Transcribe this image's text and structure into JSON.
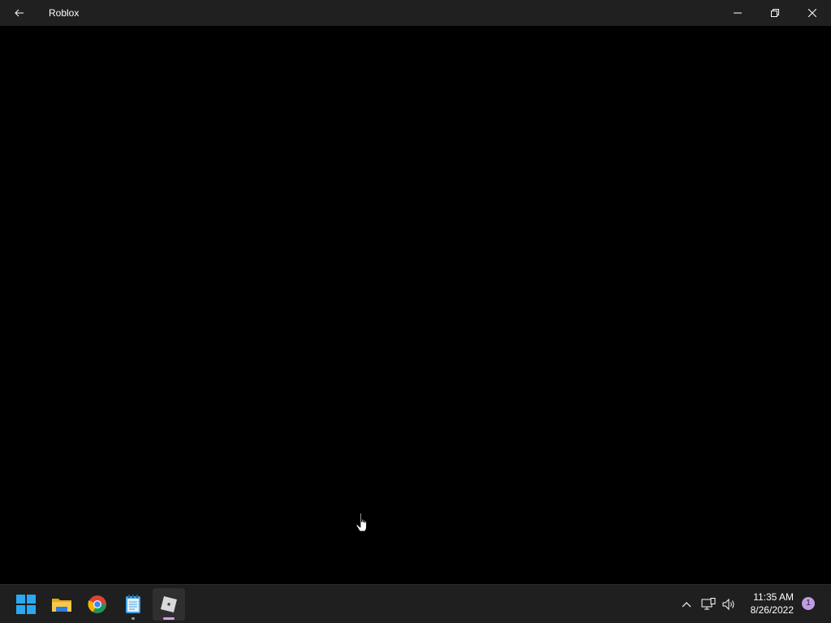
{
  "window": {
    "title": "Roblox"
  },
  "taskbar": {
    "apps": [
      {
        "name": "start",
        "icon": "windows-logo-icon"
      },
      {
        "name": "file-explorer",
        "icon": "folder-icon"
      },
      {
        "name": "chrome",
        "icon": "chrome-icon"
      },
      {
        "name": "notepad",
        "icon": "notepad-icon"
      },
      {
        "name": "roblox",
        "icon": "roblox-icon",
        "active": true
      }
    ],
    "clock": {
      "time": "11:35 AM",
      "date": "8/26/2022"
    },
    "notification_count": "1"
  },
  "colors": {
    "titlebar_bg": "#202020",
    "taskbar_bg": "#1f1f1f",
    "content_bg": "#000000",
    "accent_indicator": "#d6a2e8",
    "badge": "#c09ce6"
  }
}
